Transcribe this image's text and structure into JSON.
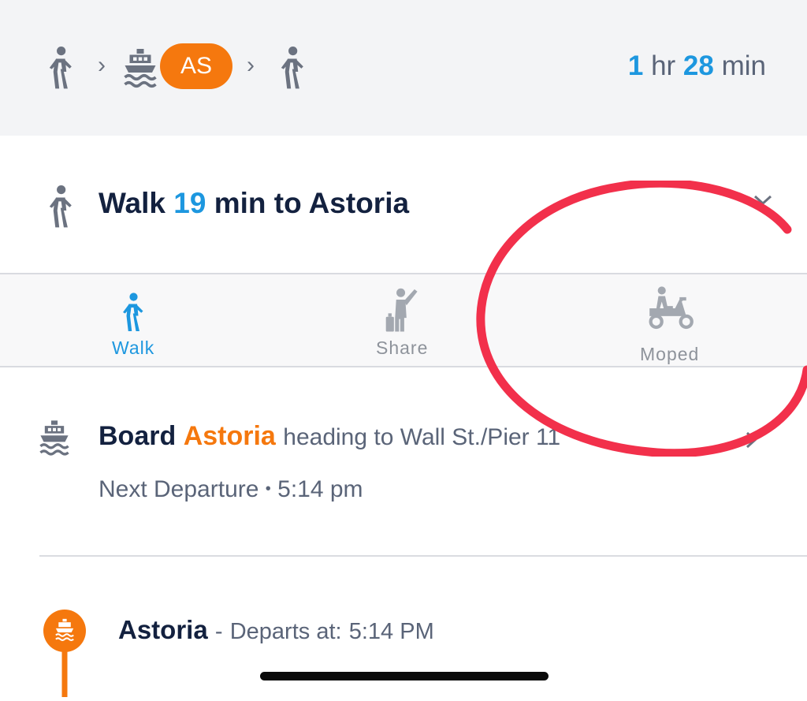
{
  "route_summary": {
    "steps": [
      {
        "icon": "walk-icon"
      },
      {
        "icon": "ferry-icon",
        "badge": "AS",
        "badge_color": "#f5780e"
      },
      {
        "icon": "walk-icon"
      }
    ],
    "separator": "›",
    "duration": {
      "hours": "1",
      "hours_unit": "hr",
      "minutes": "28",
      "minutes_unit": "min"
    }
  },
  "walk_step": {
    "verb": "Walk",
    "minutes": "19",
    "text": "min to Astoria",
    "chevron": "⌄"
  },
  "mode_options": [
    {
      "label": "Walk",
      "icon": "walk-icon",
      "selected": true
    },
    {
      "label": "Share",
      "icon": "rideshare-icon",
      "selected": false
    },
    {
      "label": "Moped",
      "icon": "moped-icon",
      "selected": false
    }
  ],
  "board_step": {
    "verb": "Board",
    "route": "Astoria",
    "heading": "heading to Wall St./Pier 11",
    "next_label": "Next Departure",
    "dot": "•",
    "next_time": "5:14 pm"
  },
  "stop": {
    "name": "Astoria",
    "dash": "-",
    "departs_label": "Departs at:",
    "departs_time": "5:14 PM"
  },
  "colors": {
    "accent_blue": "#1d97df",
    "ferry_orange": "#f5780e",
    "annotation_red": "#f2304b",
    "icon_gray": "#6b7280"
  }
}
